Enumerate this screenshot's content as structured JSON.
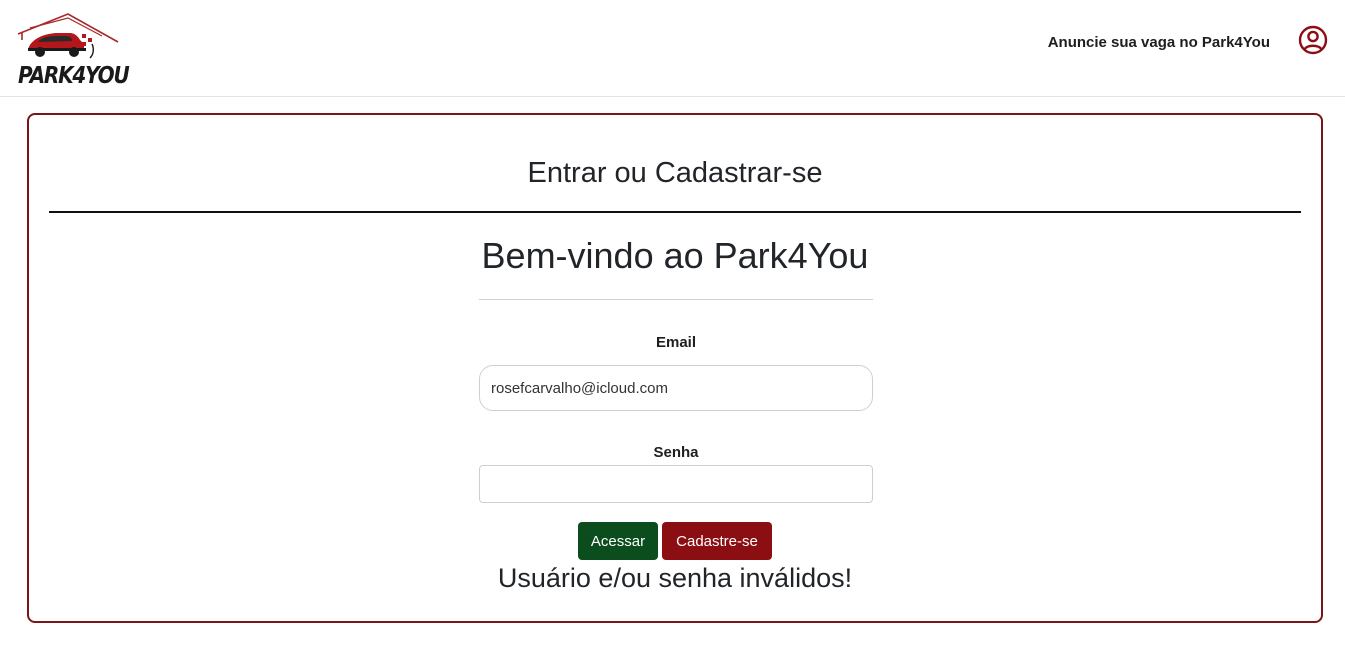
{
  "header": {
    "logo_text": "PARK4YOU",
    "nav_link": "Anuncie sua vaga no Park4You",
    "user_icon": "user-circle-icon"
  },
  "card": {
    "title": "Entrar ou Cadastrar-se",
    "welcome": "Bem-vindo ao Park4You",
    "email_label": "Email",
    "email_value": "rosefcarvalho@icloud.com",
    "senha_label": "Senha",
    "senha_value": "",
    "login_button": "Acessar",
    "signup_button": "Cadastre-se",
    "error_message": "Usuário e/ou senha inválidos!"
  },
  "colors": {
    "brand_red": "#8b0e12",
    "card_border": "#7a1518",
    "login_green": "#0b4d1c"
  }
}
